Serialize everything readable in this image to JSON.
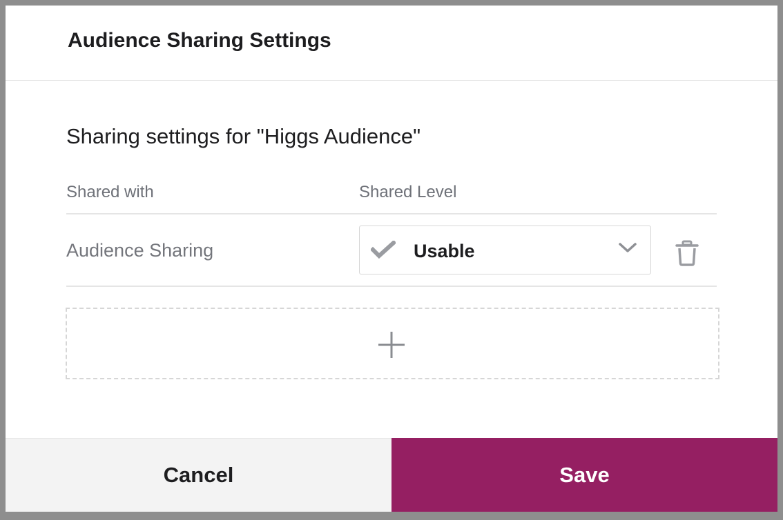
{
  "dialog": {
    "title": "Audience Sharing Settings",
    "subtitle": "Sharing settings for \"Higgs Audience\"",
    "columns": {
      "shared_with": "Shared with",
      "shared_level": "Shared Level"
    },
    "rows": [
      {
        "shared_with": "Audience Sharing",
        "level": "Usable",
        "level_icon": "check-icon",
        "remove_icon": "trash-icon"
      }
    ],
    "add_icon": "plus-icon",
    "cancel_label": "Cancel",
    "save_label": "Save"
  },
  "colors": {
    "accent": "#951f62",
    "cancel_bg": "#f3f3f3",
    "text": "#1d1d1f",
    "muted_text": "#6e7178",
    "icon_gray": "#9a9ca1"
  }
}
